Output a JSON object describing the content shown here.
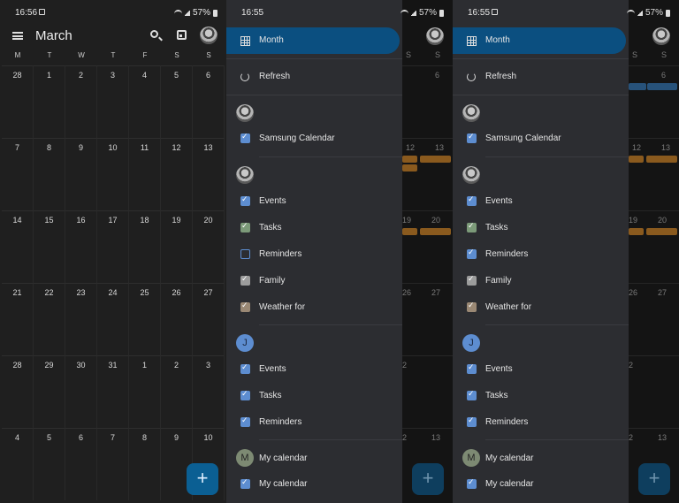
{
  "calendar": {
    "time": "16:56",
    "battery": "57%",
    "title": "March",
    "fab": "+",
    "weekdays": [
      "M",
      "T",
      "W",
      "T",
      "F",
      "S",
      "S"
    ],
    "days": [
      "28",
      "1",
      "2",
      "3",
      "4",
      "5",
      "6",
      "7",
      "8",
      "9",
      "10",
      "11",
      "12",
      "13",
      "14",
      "15",
      "16",
      "17",
      "18",
      "19",
      "20",
      "21",
      "22",
      "23",
      "24",
      "25",
      "26",
      "27",
      "28",
      "29",
      "30",
      "31",
      "1",
      "2",
      "3",
      "4",
      "5",
      "6",
      "7",
      "8",
      "9",
      "10"
    ],
    "icons": [
      "menu-icon",
      "search-icon",
      "calendar-today-icon",
      "profile-avatar"
    ]
  },
  "drawer1": {
    "time": "16:55",
    "battery": "57%",
    "month": "Month",
    "refresh": "Refresh",
    "samsung": "Samsung Calendar",
    "events": "Events",
    "tasks": "Tasks",
    "reminders": "Reminders",
    "family": "Family",
    "weather": "Weather for",
    "avatar_letter_j": "J",
    "events2": "Events",
    "tasks2": "Tasks",
    "reminders2": "Reminders",
    "avatar_letter_m": "M",
    "mycal_header": "My calendar",
    "mycal": "My calendar",
    "bg_days": [
      "6",
      "12",
      "13",
      "19",
      "20",
      "26",
      "27",
      "2",
      "13"
    ]
  },
  "drawer2": {
    "time": "16:55",
    "battery": "57%",
    "month": "Month",
    "refresh": "Refresh",
    "samsung": "Samsung Calendar",
    "events": "Events",
    "tasks": "Tasks",
    "reminders": "Reminders",
    "family": "Family",
    "weather": "Weather for",
    "avatar_letter_j": "J",
    "events2": "Events",
    "tasks2": "Tasks",
    "reminders2": "Reminders",
    "avatar_letter_m": "M",
    "mycal_header": "My calendar",
    "mycal": "My calendar",
    "bg_days": [
      "6",
      "12",
      "13",
      "19",
      "20",
      "26",
      "27",
      "2",
      "13"
    ]
  },
  "colors": {
    "blue_checkbox": "#5d8dd0",
    "green_checkbox": "#7c9a79",
    "grey_checkbox": "#9c9c9c",
    "tan_checkbox": "#9a8874",
    "active_item": "#0b4f80",
    "fab": "#0b5f93"
  }
}
